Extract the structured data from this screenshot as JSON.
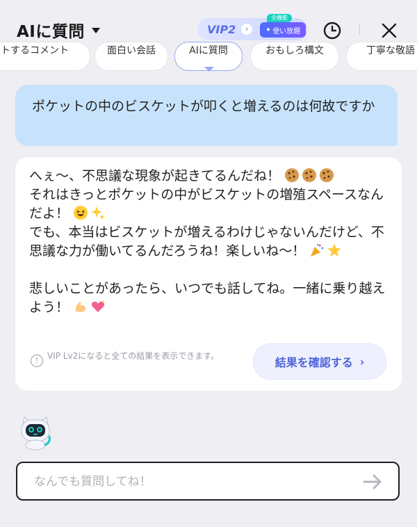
{
  "header": {
    "title": "AIに質問",
    "vip_label": "VIP2",
    "vip_tag_top": "全機能",
    "vip_tag": "使い放題"
  },
  "chips": [
    "トするコメント",
    "面白い会話",
    "AIに質問",
    "おもしろ構文",
    "丁寧な敬語"
  ],
  "user_message": "ポケットの中のビスケットが叩くと増えるのは何故ですか",
  "ai_message": {
    "line1": "へぇ〜、不思議な現象が起きてるんだね！",
    "line2": "それはきっとポケットの中がビスケットの増殖スペースなんだよ！",
    "line3": "でも、本当はビスケットが増えるわけじゃないんだけど、不思議な力が働いてるんだろうね！楽しいね〜！",
    "line4": "悲しいことがあったら、いつでも話してね。一緒に乗り越えよう！"
  },
  "notice": {
    "icon": "!",
    "text": "VIP Lv2になると全ての結果を表示できます。"
  },
  "confirm_button": "結果を確認する",
  "input": {
    "placeholder": "なんでも質問してね！"
  },
  "colors": {
    "accent": "#5a6ee8",
    "user_bubble": "#c6e3fb",
    "background": "#eeeef3"
  },
  "icons": {
    "history": "history-clock-icon",
    "close": "close-icon",
    "send": "arrow-right-icon",
    "mascot": "robot-cat-mascot"
  }
}
